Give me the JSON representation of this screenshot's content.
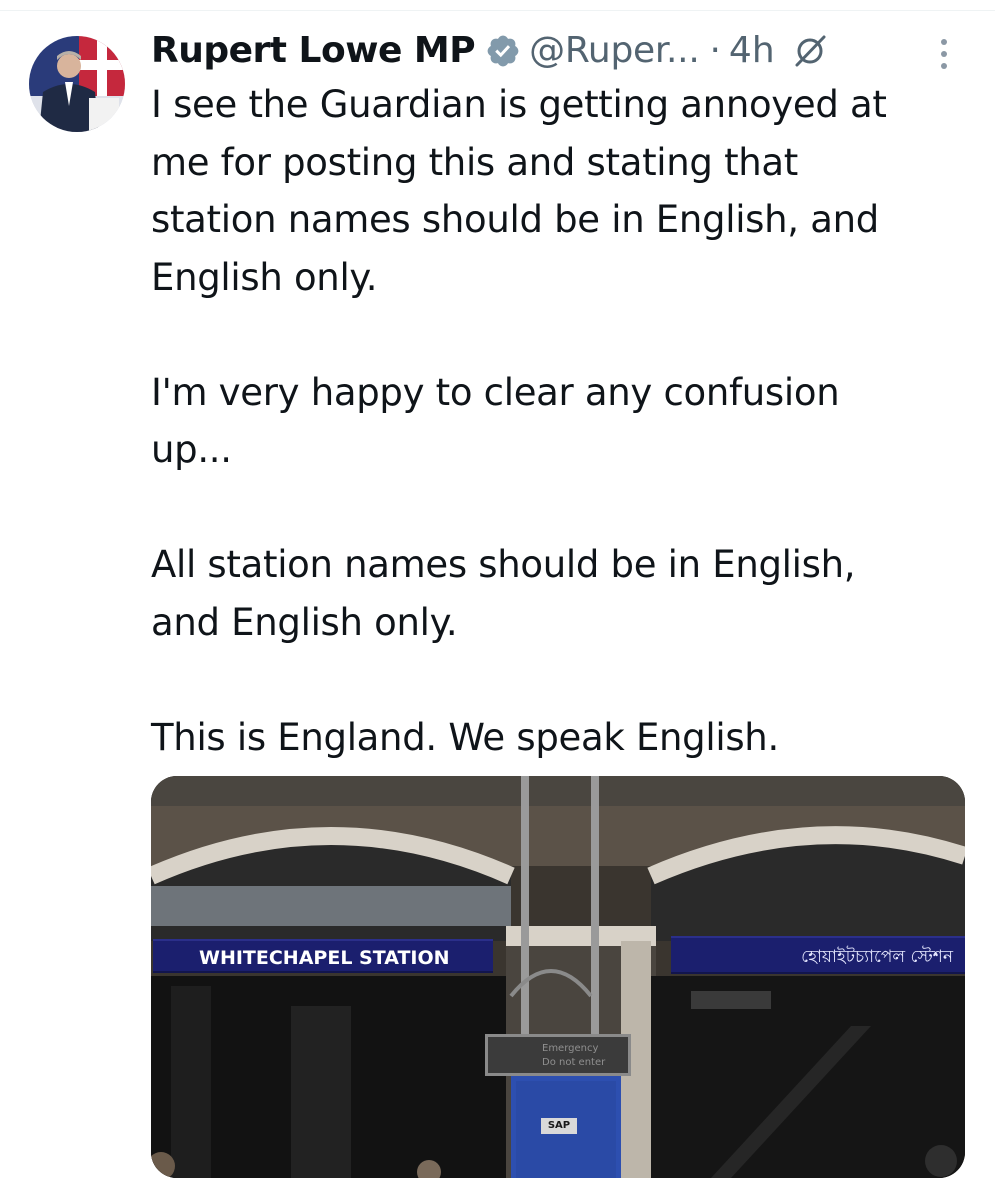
{
  "tweet": {
    "author": {
      "display_name": "Rupert Lowe MP",
      "handle": "@Ruper...",
      "verified": true
    },
    "timestamp": "4h",
    "separator": "·",
    "paragraphs": [
      [
        "I see the Guardian is getting annoyed at",
        "me for posting this and stating that",
        "station names should be in English, and",
        "English only."
      ],
      [
        "I'm very happy to clear any confusion",
        "up..."
      ],
      [
        "All station names should be in English,",
        "and English only."
      ],
      [
        "This is England. We speak English."
      ]
    ],
    "media": {
      "sign_english": "WHITECHAPEL STATION",
      "sign_bengali": "হোয়াইটচ্যাপেল স্টেশন",
      "emergency_sign": [
        "Emergency",
        "Do not enter"
      ],
      "box_label": "SAP"
    }
  },
  "icons": {
    "verified": "verified-badge-icon",
    "grok": "grok-icon",
    "more": "more-vertical-icon"
  },
  "colors": {
    "text": "#0f1419",
    "secondary": "#536471",
    "verified_badge": "#829aab",
    "sign_blue": "#1b1f6e"
  }
}
